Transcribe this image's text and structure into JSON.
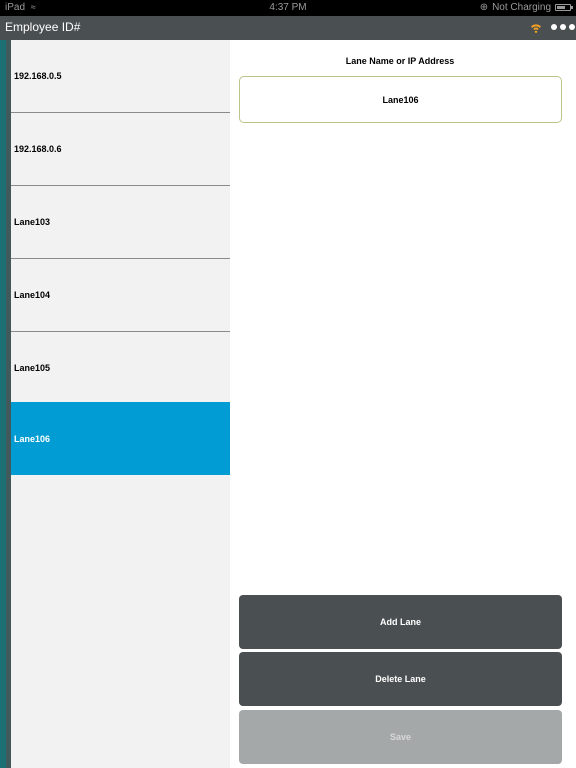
{
  "status_bar": {
    "device": "iPad",
    "time": "4:37 PM",
    "charging": "Not Charging"
  },
  "header": {
    "title": "Employee ID#"
  },
  "lanes": {
    "items": [
      {
        "label": "192.168.0.5"
      },
      {
        "label": "192.168.0.6"
      },
      {
        "label": "Lane103"
      },
      {
        "label": "Lane104"
      },
      {
        "label": "Lane105"
      },
      {
        "label": "Lane106"
      }
    ],
    "selected_index": 5
  },
  "detail": {
    "field_label": "Lane Name or IP Address",
    "field_value": "Lane106",
    "add_label": "Add Lane",
    "delete_label": "Delete Lane",
    "save_label": "Save"
  },
  "colors": {
    "header_bg": "#4a4f51",
    "selected_bg": "#009cd3",
    "wifi_icon": "#f0a020",
    "accent_strip": "#1c6f73"
  }
}
